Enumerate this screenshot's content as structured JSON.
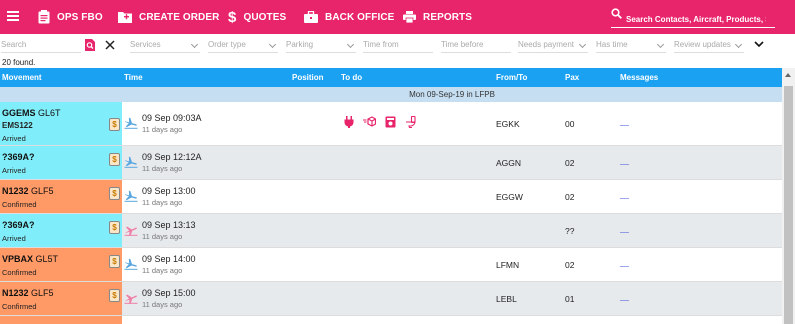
{
  "topbar": {
    "nav": [
      {
        "label": "OPS FBO",
        "icon": "clipboard-icon"
      },
      {
        "label": "CREATE ORDER",
        "icon": "add-folder-icon"
      },
      {
        "label": "QUOTES",
        "icon": "dollar-icon"
      },
      {
        "label": "BACK OFFICE",
        "icon": "briefcase-icon"
      },
      {
        "label": "REPORTS",
        "icon": "printer-icon"
      }
    ],
    "search_text": "Search Contacts, Aircraft, Products, Stati..."
  },
  "filters": {
    "search_placeholder": "Search",
    "services": "Services",
    "order_type": "Order type",
    "parking": "Parking",
    "time_from": "Time from",
    "time_before": "Time before",
    "needs_payment": "Needs payment",
    "has_time": "Has time",
    "review_updates": "Review updates"
  },
  "found_text": "20 found.",
  "columns": {
    "movement": "Movement",
    "time": "Time",
    "position": "Position",
    "todo": "To do",
    "fromto": "From/To",
    "pax": "Pax",
    "messages": "Messages"
  },
  "group_header": "Mon 09-Sep-19 in LFPB",
  "colors": {
    "brand": "#e8246a",
    "header": "#1ba1f2",
    "arrived": "#80eefa",
    "confirmed": "#ff9966",
    "arrival_plane": "#5aa7e0",
    "departure_plane": "#f07fa5"
  },
  "rows": [
    {
      "reg": "GGEMS",
      "type": "GL6T",
      "sub": "EMS122",
      "status": "Arrived",
      "time": "09 Sep 09:03A",
      "ago": "11 days ago",
      "fromto": "EGKK",
      "pax": "00",
      "msg": "__",
      "dir": "arrival",
      "todo": [
        "plug-icon",
        "cargo-icon",
        "catering-icon",
        "toilet-icon"
      ]
    },
    {
      "reg": "?369A?",
      "type": "",
      "sub": "",
      "status": "Arrived",
      "time": "09 Sep 12:12A",
      "ago": "11 days ago",
      "fromto": "AGGN",
      "pax": "02",
      "msg": "__",
      "dir": "arrival",
      "todo": []
    },
    {
      "reg": "N1232",
      "type": "GLF5",
      "sub": "",
      "status": "Confirmed",
      "time": "09 Sep 13:00",
      "ago": "11 days ago",
      "fromto": "EGGW",
      "pax": "02",
      "msg": "__",
      "dir": "arrival",
      "todo": []
    },
    {
      "reg": "?369A?",
      "type": "",
      "sub": "",
      "status": "Arrived",
      "time": "09 Sep 13:13",
      "ago": "11 days ago",
      "fromto": "",
      "pax": "??",
      "msg": "__",
      "dir": "departure",
      "todo": []
    },
    {
      "reg": "VPBAX",
      "type": "GL5T",
      "sub": "",
      "status": "Confirmed",
      "time": "09 Sep 14:00",
      "ago": "11 days ago",
      "fromto": "LFMN",
      "pax": "02",
      "msg": "__",
      "dir": "arrival",
      "todo": []
    },
    {
      "reg": "N1232",
      "type": "GLF5",
      "sub": "",
      "status": "Confirmed",
      "time": "09 Sep 15:00",
      "ago": "11 days ago",
      "fromto": "LEBL",
      "pax": "01",
      "msg": "__",
      "dir": "departure",
      "todo": []
    }
  ]
}
